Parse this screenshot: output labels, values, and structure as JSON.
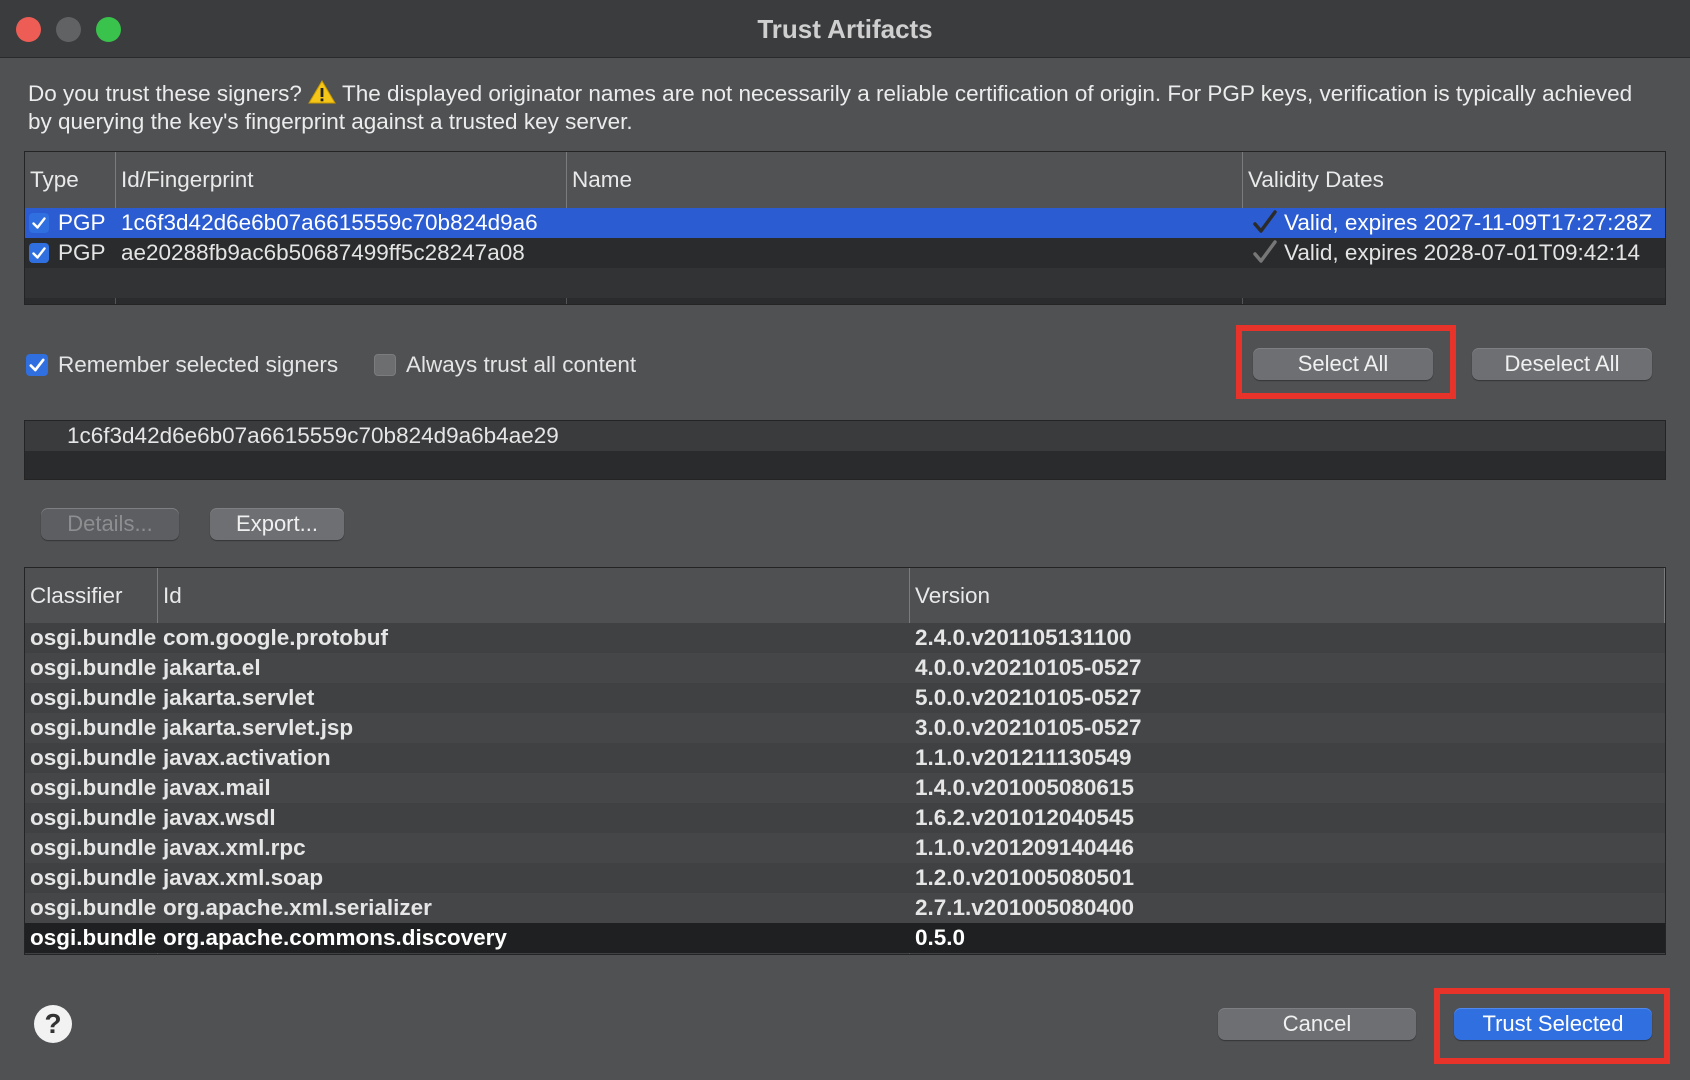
{
  "window": {
    "title": "Trust Artifacts"
  },
  "description": {
    "lead": "Do you trust these signers?",
    "rest": " The displayed originator names are not necessarily a reliable certification of origin.  For PGP keys, verification is typically achieved by querying the key's fingerprint against a trusted key server."
  },
  "signers_table": {
    "headers": [
      "Type",
      "Id/Fingerprint",
      "Name",
      "Validity Dates"
    ],
    "rows": [
      {
        "checked": true,
        "type": "PGP",
        "fingerprint": "1c6f3d42d6e6b07a6615559c70b824d9a6",
        "name": "",
        "validity": "Valid, expires 2027-11-09T17:27:28Z",
        "selected": true
      },
      {
        "checked": true,
        "type": "PGP",
        "fingerprint": "ae20288fb9ac6b50687499ff5c28247a08",
        "name": "",
        "validity": "Valid, expires 2028-07-01T09:42:14",
        "selected": false
      }
    ]
  },
  "options": {
    "remember_label": "Remember selected signers",
    "remember_checked": true,
    "always_trust_label": "Always trust all content",
    "always_trust_checked": false
  },
  "buttons": {
    "select_all": "Select All",
    "deselect_all": "Deselect All",
    "details": "Details...",
    "export": "Export...",
    "cancel": "Cancel",
    "trust_selected": "Trust Selected",
    "help": "?"
  },
  "selected_fingerprint": "1c6f3d42d6e6b07a6615559c70b824d9a6b4ae29",
  "artifacts_table": {
    "headers": [
      "Classifier",
      "Id",
      "Version"
    ],
    "rows": [
      {
        "classifier": "osgi.bundle",
        "id": "com.google.protobuf",
        "version": "2.4.0.v201105131100"
      },
      {
        "classifier": "osgi.bundle",
        "id": "jakarta.el",
        "version": "4.0.0.v20210105-0527"
      },
      {
        "classifier": "osgi.bundle",
        "id": "jakarta.servlet",
        "version": "5.0.0.v20210105-0527"
      },
      {
        "classifier": "osgi.bundle",
        "id": "jakarta.servlet.jsp",
        "version": "3.0.0.v20210105-0527"
      },
      {
        "classifier": "osgi.bundle",
        "id": "javax.activation",
        "version": "1.1.0.v201211130549"
      },
      {
        "classifier": "osgi.bundle",
        "id": "javax.mail",
        "version": "1.4.0.v201005080615"
      },
      {
        "classifier": "osgi.bundle",
        "id": "javax.wsdl",
        "version": "1.6.2.v201012040545"
      },
      {
        "classifier": "osgi.bundle",
        "id": "javax.xml.rpc",
        "version": "1.1.0.v201209140446"
      },
      {
        "classifier": "osgi.bundle",
        "id": "javax.xml.soap",
        "version": "1.2.0.v201005080501"
      },
      {
        "classifier": "osgi.bundle",
        "id": "org.apache.xml.serializer",
        "version": "2.7.1.v201005080400"
      },
      {
        "classifier": "osgi.bundle",
        "id": "org.apache.commons.discovery",
        "version": "0.5.0"
      }
    ]
  },
  "colors": {
    "accent": "#2f6fe0",
    "highlight": "#e8332a"
  }
}
